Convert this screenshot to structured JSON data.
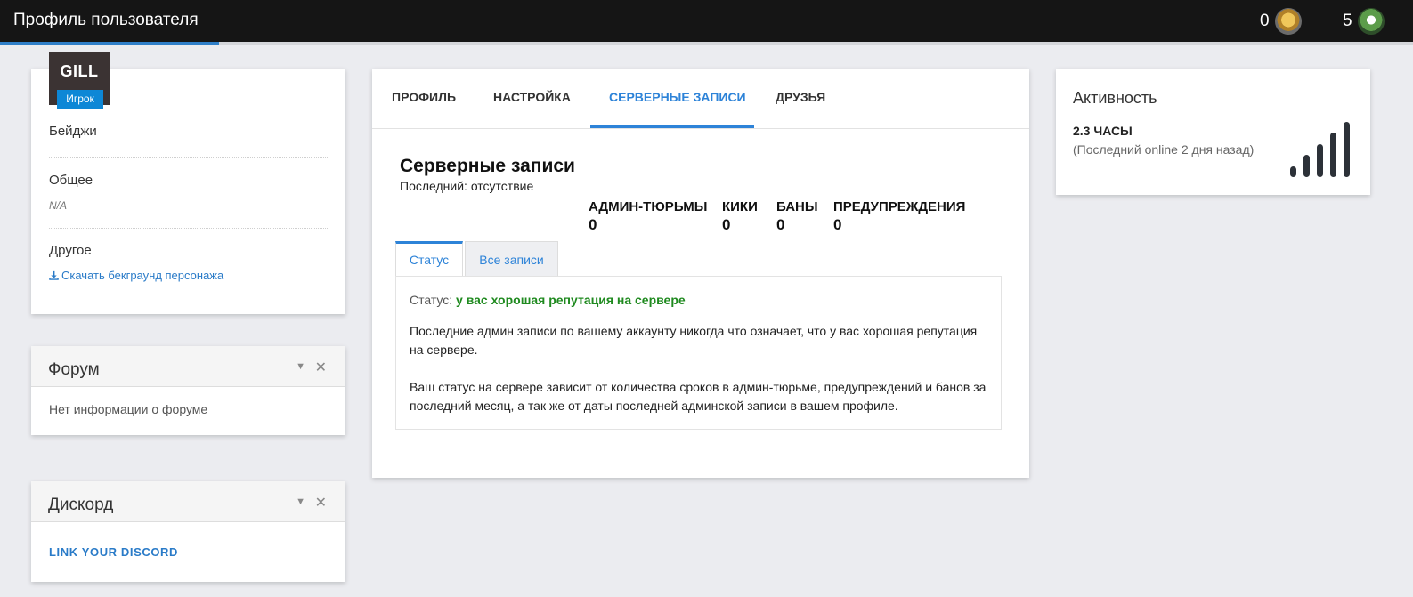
{
  "header": {
    "title": "Профиль пользователя",
    "progress_percent": 15.5,
    "counters": [
      {
        "value": "0",
        "icon": "gold-badge-icon"
      },
      {
        "value": "5",
        "icon": "green-character-icon"
      }
    ]
  },
  "profile": {
    "name": "GILL",
    "role_badge": "Игрок",
    "badges_label": "Бейджи",
    "general_label": "Общее",
    "general_value": "N/A",
    "other_label": "Другое",
    "download_link": "Скачать бекграунд персонажа"
  },
  "forum": {
    "title": "Форум",
    "body": "Нет информации о форуме"
  },
  "discord": {
    "title": "Дискорд",
    "link": "LINK YOUR DISCORD"
  },
  "tabs": [
    {
      "label": "ПРОФИЛЬ",
      "active": false
    },
    {
      "label": "НАСТРОЙКА",
      "active": false
    },
    {
      "label": "СЕРВЕРНЫЕ ЗАПИСИ",
      "active": true
    },
    {
      "label": "ДРУЗЬЯ",
      "active": false
    }
  ],
  "records": {
    "title": "Серверные записи",
    "subtitle": "Последний: отсутствие",
    "stats": [
      {
        "label": "АДМИН-ТЮРЬМЫ",
        "value": "0"
      },
      {
        "label": "КИКИ",
        "value": "0"
      },
      {
        "label": "БАНЫ",
        "value": "0"
      },
      {
        "label": "ПРЕДУПРЕЖДЕНИЯ",
        "value": "0"
      }
    ],
    "subtabs": [
      {
        "label": "Статус",
        "active": true
      },
      {
        "label": "Все записи",
        "active": false
      }
    ],
    "status_prefix": "Статус:",
    "status_value": "у вас хорошая репутация на сервере",
    "paragraph_1": "Последние админ записи по вашему аккаунту никогда что означает, что у вас хорошая репутация на сервере.",
    "paragraph_2": "Ваш статус на сервере зависит от количества сроков в админ-тюрьме, предупреждений и банов за последний месяц, а так же от даты последней админской записи в вашем профиле."
  },
  "activity": {
    "title": "Активность",
    "hours": "2.3 ЧАСЫ",
    "last_online": "(Последний online 2 дня назад)",
    "signal_bars": 5,
    "signal_color": "#2c3138"
  },
  "colors": {
    "accent": "#2d83d8",
    "status_good": "#1f8a1f",
    "role_badge": "#0d87d6"
  }
}
